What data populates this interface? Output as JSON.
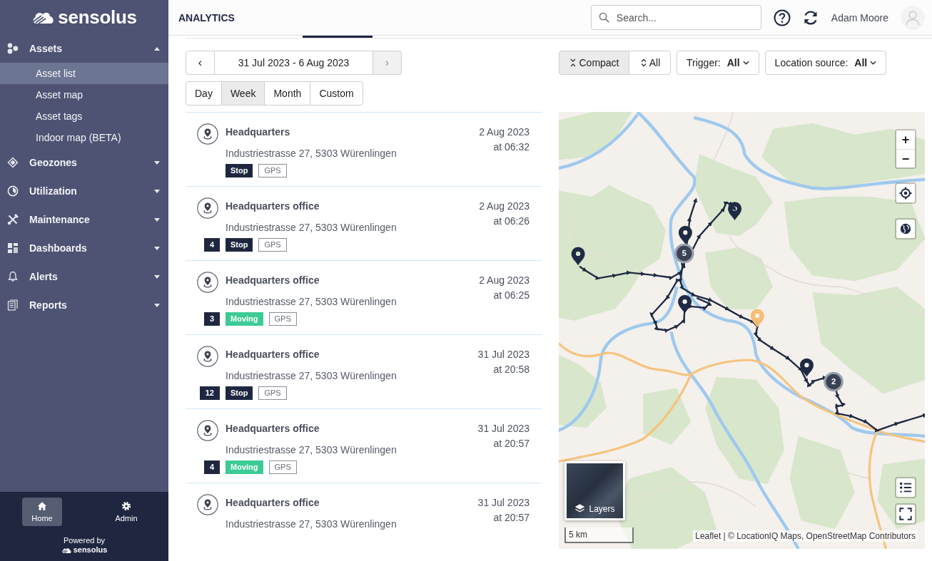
{
  "sidebar": {
    "logo": "sensolus",
    "sections": [
      {
        "label": "Assets",
        "kind": "assets",
        "expanded": true,
        "children": [
          {
            "label": "Asset list",
            "selected": true
          },
          {
            "label": "Asset map",
            "selected": false
          },
          {
            "label": "Asset tags",
            "selected": false
          },
          {
            "label": "Indoor map (BETA)",
            "selected": false
          }
        ]
      },
      {
        "label": "Geozones",
        "kind": "geozones",
        "expanded": false
      },
      {
        "label": "Utilization",
        "kind": "utilization",
        "expanded": false
      },
      {
        "label": "Maintenance",
        "kind": "maintenance",
        "expanded": false
      },
      {
        "label": "Dashboards",
        "kind": "dashboards",
        "expanded": false
      },
      {
        "label": "Alerts",
        "kind": "alerts",
        "expanded": false
      },
      {
        "label": "Reports",
        "kind": "reports",
        "expanded": false
      }
    ],
    "bottom_nav": [
      {
        "label": "Home",
        "kind": "home",
        "selected": true
      },
      {
        "label": "Admin",
        "kind": "admin",
        "selected": false
      }
    ],
    "powered_by": "Powered by",
    "powered_logo": "sensolus"
  },
  "header": {
    "title": "ANALYTICS",
    "search": {
      "placeholder": "Search..."
    },
    "user": "Adam Moore"
  },
  "date_range": {
    "prev": "‹",
    "label": "31 Jul 2023 - 6 Aug 2023",
    "next": "›",
    "next_disabled": true
  },
  "periods": [
    {
      "label": "Day",
      "selected": false
    },
    {
      "label": "Week",
      "selected": true
    },
    {
      "label": "Month",
      "selected": false
    },
    {
      "label": "Custom",
      "selected": false
    }
  ],
  "view_modes": [
    {
      "label": "Compact",
      "kind": "collapse",
      "selected": true
    },
    {
      "label": "All",
      "kind": "expand",
      "selected": false
    }
  ],
  "filters": [
    {
      "label": "Trigger:",
      "value": "All"
    },
    {
      "label": "Location source:",
      "value": "All"
    }
  ],
  "events": [
    {
      "title": "Headquarters",
      "address": "Industriestrasse 27, 5303 Würenlingen",
      "date": "2 Aug 2023",
      "time": "at 06:32",
      "tags": [
        {
          "label": "Stop",
          "kind": "stop"
        },
        {
          "label": "GPS",
          "kind": "source"
        }
      ]
    },
    {
      "title": "Headquarters office",
      "address": "Industriestrasse 27, 5303 Würenlingen",
      "date": "2 Aug 2023",
      "time": "at 06:26",
      "count": "4",
      "tags": [
        {
          "label": "Stop",
          "kind": "stop"
        },
        {
          "label": "GPS",
          "kind": "source"
        }
      ]
    },
    {
      "title": "Headquarters office",
      "address": "Industriestrasse 27, 5303 Würenlingen",
      "date": "2 Aug 2023",
      "time": "at 06:25",
      "count": "3",
      "tags": [
        {
          "label": "Moving",
          "kind": "moving"
        },
        {
          "label": "GPS",
          "kind": "source"
        }
      ]
    },
    {
      "title": "Headquarters office",
      "address": "Industriestrasse 27, 5303 Würenlingen",
      "date": "31 Jul 2023",
      "time": "at 20:58",
      "count": "12",
      "tags": [
        {
          "label": "Stop",
          "kind": "stop"
        },
        {
          "label": "GPS",
          "kind": "source"
        }
      ]
    },
    {
      "title": "Headquarters office",
      "address": "Industriestrasse 27, 5303 Würenlingen",
      "date": "31 Jul 2023",
      "time": "at 20:57",
      "count": "4",
      "tags": [
        {
          "label": "Moving",
          "kind": "moving"
        },
        {
          "label": "GPS",
          "kind": "source"
        }
      ]
    },
    {
      "title": "Headquarters office",
      "address": "Industriestrasse 27, 5303 Würenlingen",
      "date": "31 Jul 2023",
      "time": "at 20:57"
    }
  ],
  "map": {
    "zoom_in": "+",
    "zoom_out": "−",
    "layers": "Layers",
    "scale": "5 km",
    "attribution": "Leaflet | © LocationIQ Maps, OpenStreetMap Contributors",
    "pins": [
      {
        "color": "#1f2a44"
      },
      {
        "color": "#1f2a44"
      },
      {
        "color": "#1f2a44"
      },
      {
        "color": "#1f2a44"
      },
      {
        "color": "#f7bd74"
      },
      {
        "color": "#1f2a44"
      }
    ],
    "clusters": [
      {
        "count": "5"
      },
      {
        "count": "2"
      }
    ]
  }
}
